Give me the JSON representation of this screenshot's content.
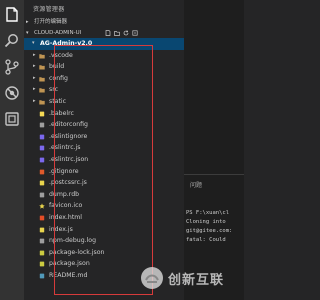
{
  "explorer": {
    "title": "资源管理器",
    "open_editors_label": "打开的编辑器",
    "folder_label": "CLOUD-ADMIN-UI"
  },
  "activity_bar": {
    "icons": [
      "files-icon",
      "search-icon",
      "source-control-icon",
      "debug-icon",
      "extensions-icon"
    ]
  },
  "tree": {
    "root": {
      "label": "AG-Admin-v2.0"
    },
    "items": [
      {
        "label": ".vscode",
        "kind": "folder"
      },
      {
        "label": "build",
        "kind": "folder"
      },
      {
        "label": "config",
        "kind": "folder"
      },
      {
        "label": "src",
        "kind": "folder"
      },
      {
        "label": "static",
        "kind": "folder"
      },
      {
        "label": ".babelrc",
        "kind": "babel"
      },
      {
        "label": ".editorconfig",
        "kind": "config"
      },
      {
        "label": ".eslintignore",
        "kind": "eslint"
      },
      {
        "label": ".eslintrc.js",
        "kind": "eslint"
      },
      {
        "label": ".eslintrc.json",
        "kind": "eslint"
      },
      {
        "label": ".gitignore",
        "kind": "git"
      },
      {
        "label": ".postcssrc.js",
        "kind": "js"
      },
      {
        "label": "dump.rdb",
        "kind": "db"
      },
      {
        "label": "favicon.ico",
        "kind": "favicon"
      },
      {
        "label": "index.html",
        "kind": "html"
      },
      {
        "label": "index.js",
        "kind": "js"
      },
      {
        "label": "npm-debug.log",
        "kind": "log"
      },
      {
        "label": "package-lock.json",
        "kind": "json"
      },
      {
        "label": "package.json",
        "kind": "json"
      },
      {
        "label": "README.md",
        "kind": "md"
      }
    ]
  },
  "panel": {
    "tab_label": "问题",
    "terminal_lines": [
      "PS F:\\xuan\\cl",
      "Cloning into",
      "git@gitee.com:",
      "fatal: Could"
    ]
  },
  "watermark": {
    "text": "创新互联"
  },
  "colors": {
    "activity_bar": "#333333",
    "sidebar": "#252526",
    "editor": "#1e1e1e",
    "selection": "#094771",
    "highlight_box": "#d63b3b"
  }
}
